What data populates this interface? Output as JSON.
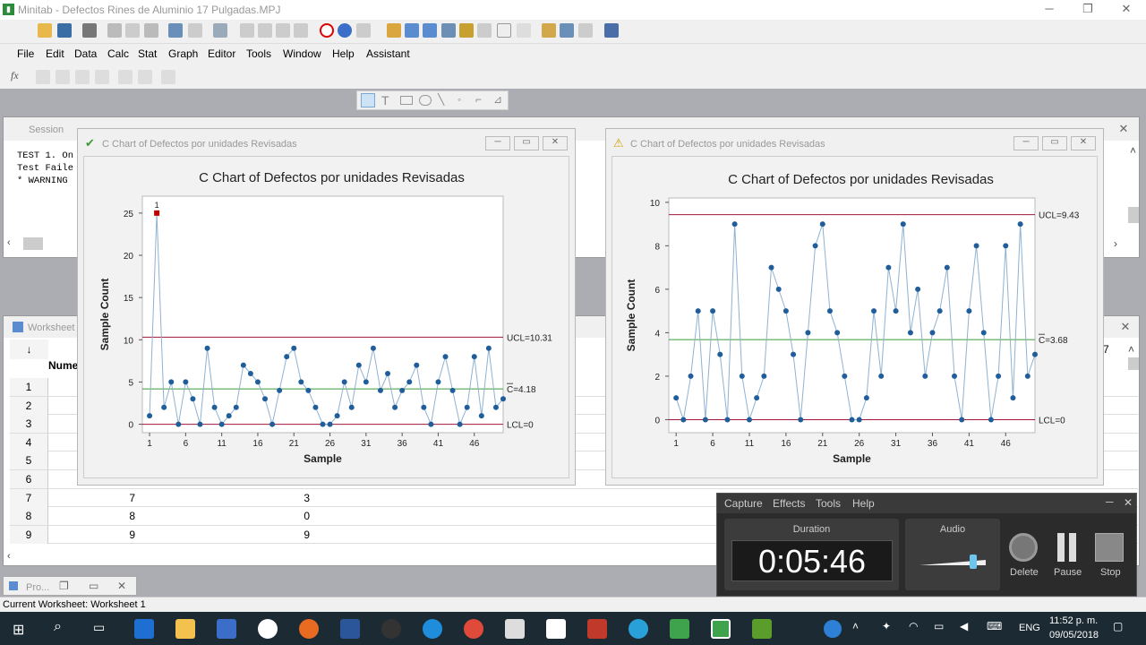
{
  "window": {
    "title": "Minitab - Defectos Rines de Aluminio 17 Pulgadas.MPJ"
  },
  "menu": [
    "File",
    "Edit",
    "Data",
    "Calc",
    "Stat",
    "Graph",
    "Editor",
    "Tools",
    "Window",
    "Help",
    "Assistant"
  ],
  "session": {
    "title": "Session",
    "lines": [
      "TEST 1. On",
      "Test Faile",
      "",
      "* WARNING"
    ]
  },
  "worksheet": {
    "title": "Worksheet",
    "col_header": "Nume",
    "rows": [
      {
        "n": "1",
        "a": "",
        "b": ""
      },
      {
        "n": "2",
        "a": "",
        "b": ""
      },
      {
        "n": "3",
        "a": "",
        "b": ""
      },
      {
        "n": "4",
        "a": "",
        "b": ""
      },
      {
        "n": "5",
        "a": "",
        "b": ""
      },
      {
        "n": "6",
        "a": "",
        "b": ""
      },
      {
        "n": "7",
        "a": "7",
        "b": "3"
      },
      {
        "n": "8",
        "a": "8",
        "b": "0"
      },
      {
        "n": "9",
        "a": "9",
        "b": "9"
      }
    ],
    "right_num": "7"
  },
  "chart1": {
    "window_title": "C Chart of Defectos por unidades Revisadas",
    "title": "C Chart of Defectos por unidades Revisadas",
    "xlabel": "Sample",
    "ylabel": "Sample Count",
    "ucl_label": "UCL=10.31",
    "cl_label": "C=4.18",
    "lcl_label": "LCL=0",
    "flag": "1"
  },
  "chart2": {
    "window_title": "C Chart of Defectos por unidades Revisadas",
    "title": "C Chart of Defectos por unidades Revisadas",
    "xlabel": "Sample",
    "ylabel": "Sample Count",
    "ucl_label": "UCL=9.43",
    "cl_label": "C=3.68",
    "lcl_label": "LCL=0"
  },
  "chart_data": [
    {
      "type": "line",
      "title": "C Chart of Defectos por unidades Revisadas",
      "xlabel": "Sample",
      "ylabel": "Sample Count",
      "x_ticks": [
        1,
        6,
        11,
        16,
        21,
        26,
        31,
        36,
        41,
        46
      ],
      "y_ticks": [
        0,
        5,
        10,
        15,
        20,
        25
      ],
      "ylim": [
        -1,
        27
      ],
      "xlim": [
        0,
        50
      ],
      "ucl": 10.31,
      "cl": 4.18,
      "lcl": 0,
      "values": [
        1,
        25,
        2,
        5,
        0,
        5,
        3,
        0,
        9,
        2,
        0,
        1,
        2,
        7,
        6,
        5,
        3,
        0,
        4,
        8,
        9,
        5,
        4,
        2,
        0,
        0,
        1,
        5,
        2,
        7,
        5,
        9,
        4,
        6,
        2,
        4,
        5,
        7,
        2,
        0,
        5,
        8,
        4,
        0,
        2,
        8,
        1,
        9,
        2,
        3
      ],
      "out_of_control": [
        2
      ]
    },
    {
      "type": "line",
      "title": "C Chart of Defectos por unidades Revisadas",
      "xlabel": "Sample",
      "ylabel": "Sample Count",
      "x_ticks": [
        1,
        6,
        11,
        16,
        21,
        26,
        31,
        36,
        41,
        46
      ],
      "y_ticks": [
        0,
        2,
        4,
        6,
        8,
        10
      ],
      "ylim": [
        -0.6,
        10.2
      ],
      "xlim": [
        0,
        50
      ],
      "ucl": 9.43,
      "cl": 3.68,
      "lcl": 0,
      "values": [
        1,
        0,
        2,
        5,
        0,
        5,
        3,
        0,
        9,
        2,
        0,
        1,
        2,
        7,
        6,
        5,
        3,
        0,
        4,
        8,
        9,
        5,
        4,
        2,
        0,
        0,
        1,
        5,
        2,
        7,
        5,
        9,
        4,
        6,
        2,
        4,
        5,
        7,
        2,
        0,
        5,
        8,
        4,
        0,
        2,
        8,
        1,
        9,
        2,
        3
      ]
    }
  ],
  "recorder": {
    "menu": [
      "Capture",
      "Effects",
      "Tools",
      "Help"
    ],
    "duration_label": "Duration",
    "duration": "0:05:46",
    "audio_label": "Audio",
    "delete_label": "Delete",
    "pause_label": "Pause",
    "stop_label": "Stop"
  },
  "project": {
    "label": "Pro..."
  },
  "status": {
    "text": "Current Worksheet: Worksheet 1"
  },
  "taskbar": {
    "lang": "ENG",
    "time": "11:52 p. m.",
    "date": "09/05/2018"
  },
  "colors": {
    "ucl": "#a4153a",
    "cl": "#3a9a3a",
    "series": "#1f5e9a",
    "flag": "#c00000"
  }
}
